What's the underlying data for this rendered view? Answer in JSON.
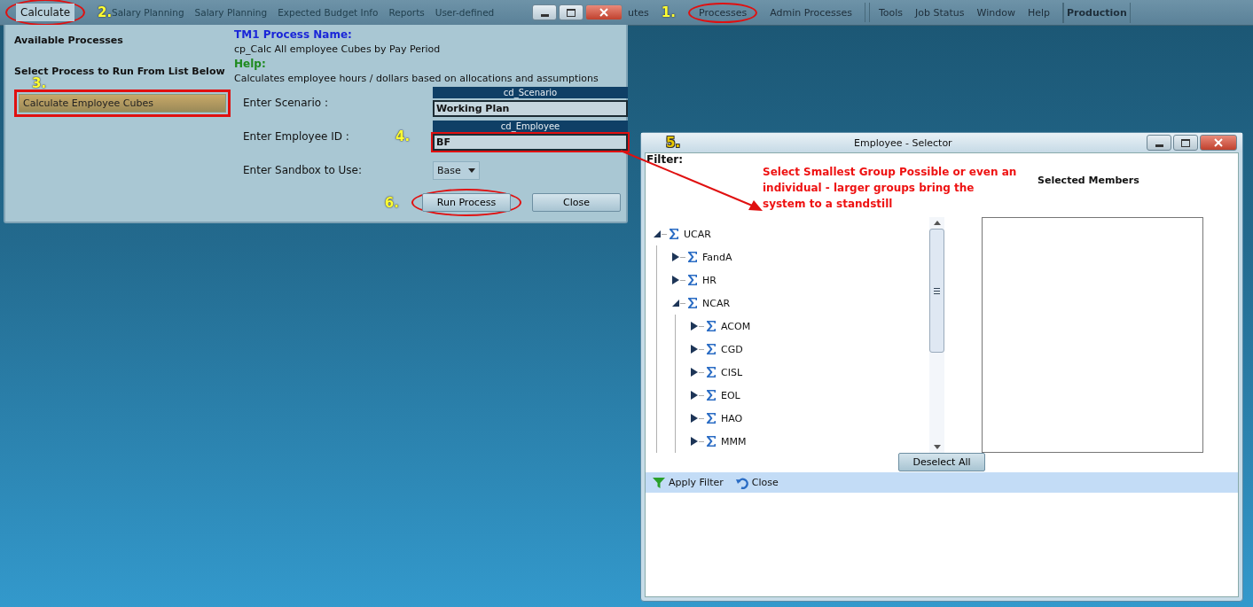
{
  "menu_bar": {
    "items_behind_dialog": [
      {
        "label": "Salary Planning"
      },
      {
        "label": "Salary Planning"
      },
      {
        "label": "Expected Budget Info"
      },
      {
        "label": "Reports"
      },
      {
        "label": "User-defined"
      }
    ],
    "items": [
      {
        "label": "utes",
        "kind": "item"
      },
      {
        "label": "Processes",
        "kind": "item",
        "marker": "1.",
        "circled": true
      },
      {
        "label": "Admin Processes",
        "kind": "item"
      },
      {
        "label": "Tools",
        "kind": "group-start"
      },
      {
        "label": "Job Status",
        "kind": "item"
      },
      {
        "label": "Window",
        "kind": "item"
      },
      {
        "label": "Help",
        "kind": "item"
      },
      {
        "label": "Production",
        "kind": "current"
      }
    ]
  },
  "process_dialog": {
    "tab": {
      "label": "Calculate",
      "marker": "2.",
      "circled": true
    },
    "available_title": "Available Processes",
    "select_title": "Select Process to Run From List Below",
    "processes": [
      {
        "label": "Calculate Employee Cubes",
        "selected": true,
        "marker": "3.",
        "boxed": true
      }
    ],
    "process_name_title": "TM1 Process Name:",
    "process_name": "cp_Calc All employee Cubes by Pay Period",
    "help_title": "Help:",
    "help_text": "Calculates employee hours / dollars based on allocations and assumptions",
    "params": [
      {
        "label": "Enter Scenario :",
        "kind": "field",
        "header": "cd_Scenario",
        "value": "Working Plan",
        "boxed": false
      },
      {
        "label": "Enter Employee ID :",
        "kind": "field",
        "header": "cd_Employee",
        "value": "BF",
        "boxed": true,
        "marker": "4."
      },
      {
        "label": "Enter Sandbox to Use:",
        "kind": "dropdown",
        "value": "Base"
      }
    ],
    "buttons": [
      {
        "label": "Run Process",
        "marker": "6.",
        "circled": true
      },
      {
        "label": "Close",
        "circled": false
      }
    ]
  },
  "selector": {
    "title": "Employee - Selector",
    "marker": "5.",
    "filter_label": "Filter:",
    "note": "Select Smallest Group Possible or even an individual - larger groups bring the system to a standstill",
    "selected_title": "Selected Members",
    "tree": [
      {
        "label": "UCAR",
        "expanded": true,
        "children": [
          {
            "label": "FandA",
            "expanded": false
          },
          {
            "label": "HR",
            "expanded": false
          },
          {
            "label": "NCAR",
            "expanded": true,
            "children": [
              {
                "label": "ACOM",
                "expanded": false
              },
              {
                "label": "CGD",
                "expanded": false
              },
              {
                "label": "CISL",
                "expanded": false
              },
              {
                "label": "EOL",
                "expanded": false
              },
              {
                "label": "HAO",
                "expanded": false
              },
              {
                "label": "MMM",
                "expanded": false
              }
            ]
          }
        ]
      }
    ],
    "deselect_button": "Deselect All",
    "toolbar": [
      {
        "label": "Apply Filter",
        "kind": "filter"
      },
      {
        "label": "Close",
        "kind": "undo"
      }
    ]
  }
}
